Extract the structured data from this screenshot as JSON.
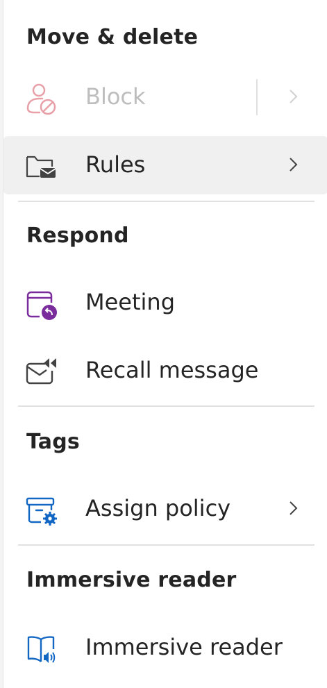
{
  "sections": {
    "move_delete": {
      "title": "Move & delete"
    },
    "respond": {
      "title": "Respond"
    },
    "tags": {
      "title": "Tags"
    },
    "immersive": {
      "title": "Immersive reader"
    }
  },
  "items": {
    "block": {
      "label": "Block",
      "icon": "block-person-icon",
      "disabled": true
    },
    "rules": {
      "label": "Rules",
      "icon": "folder-mail-icon"
    },
    "meeting": {
      "label": "Meeting",
      "icon": "calendar-reply-icon"
    },
    "recall": {
      "label": "Recall message",
      "icon": "mail-rewind-icon"
    },
    "assign_policy": {
      "label": "Assign policy",
      "icon": "archive-settings-icon"
    },
    "immersive_reader": {
      "label": "Immersive reader",
      "icon": "book-speaker-icon"
    }
  },
  "colors": {
    "text": "#242424",
    "disabled_text": "#bdbdbd",
    "purple": "#7b2c9c",
    "blue": "#1267c4",
    "block_red": "#e8a0a8",
    "hover_bg": "#f0f0f0",
    "divider": "#e1e1e1"
  }
}
